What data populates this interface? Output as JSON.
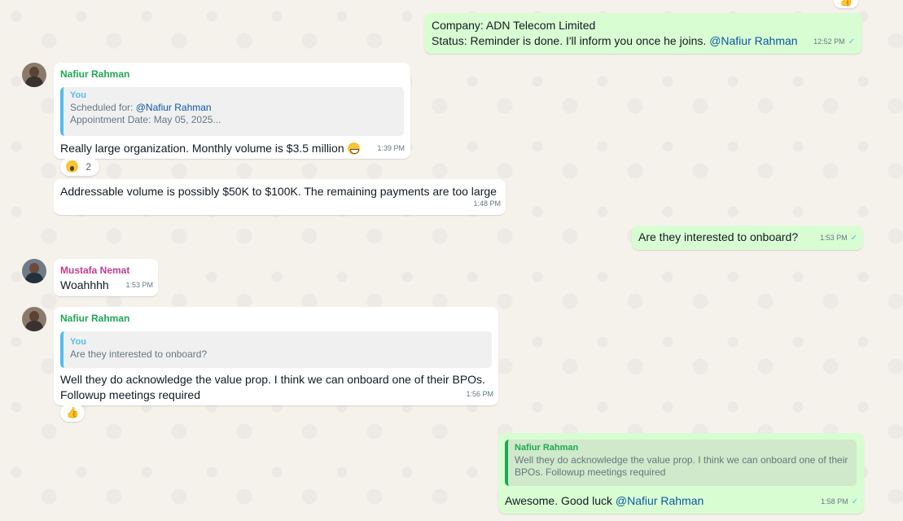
{
  "colors": {
    "outgoing_bg": "#d9fdd3",
    "incoming_bg": "#ffffff",
    "mention": "#0b57a3",
    "tick": "#53bdeb"
  },
  "messages": [
    {
      "direction": "out",
      "lines": [
        "Company: ADN Telecom Limited",
        "Status: Reminder is done. I'll inform you once he joins. "
      ],
      "mention": "@Nafiur Rahman",
      "time": "12:52 PM",
      "status_icon": "check-icon"
    },
    {
      "direction": "in",
      "sender": "Nafiur Rahman",
      "avatar_icon": "person-avatar",
      "quote": {
        "author": "You",
        "line1_prefix": "Scheduled for: ",
        "line1_mention": "@Nafiur Rahman",
        "line2": "Appointment Date: May 05, 2025..."
      },
      "text": "Really large organization. Monthly volume is $3.5 million",
      "emoji_icon": "grinning-sweat-emoji",
      "time": "1:39 PM",
      "reaction": {
        "icon": "surprised-face-emoji",
        "count": "2"
      }
    },
    {
      "direction": "in",
      "text": "Addressable volume is possibly $50K to $100K. The remaining payments are too large",
      "time": "1:48 PM"
    },
    {
      "direction": "out",
      "text": "Are they interested to onboard?",
      "time": "1:53 PM",
      "status_icon": "check-icon"
    },
    {
      "direction": "in",
      "sender": "Mustafa Nemat",
      "avatar_icon": "person-avatar",
      "text": "Woahhhh",
      "time": "1:53 PM"
    },
    {
      "direction": "in",
      "sender": "Nafiur Rahman",
      "avatar_icon": "person-avatar",
      "quote": {
        "author": "You",
        "line1": "Are they interested to onboard?"
      },
      "lines": [
        "Well they do acknowledge the value prop. I think we can onboard one of their BPOs.",
        "Followup meetings required"
      ],
      "time": "1:56 PM",
      "reaction": {
        "icon": "thumbs-up-emoji"
      }
    },
    {
      "direction": "out",
      "quote": {
        "author": "Nafiur Rahman",
        "line1": "Well they do acknowledge the value prop. I think we can onboard one of their",
        "line2": "BPOs. Followup meetings required"
      },
      "text": "Awesome. Good luck ",
      "mention": "@Nafiur Rahman",
      "time": "1:58 PM",
      "status_icon": "check-icon"
    }
  ],
  "top_reaction": {
    "icon": "thumbs-up-emoji"
  }
}
